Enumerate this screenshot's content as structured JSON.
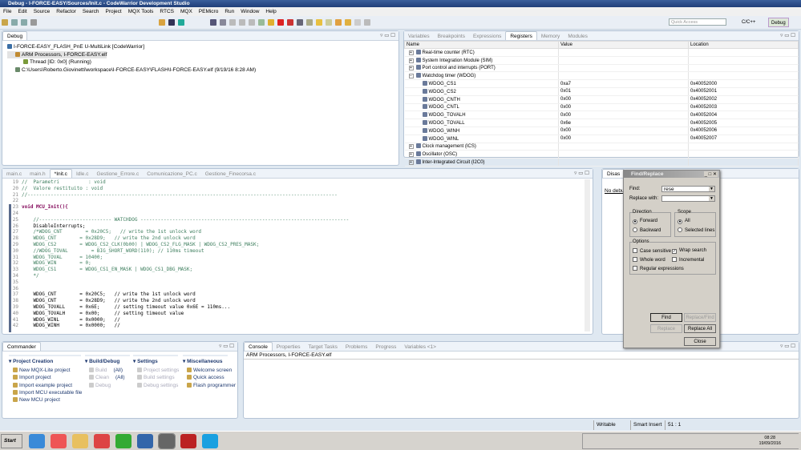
{
  "window": {
    "title": "Debug - I-FORCE-EASY/Sources/Init.c - CodeWarrior Development Studio"
  },
  "menu": [
    "File",
    "Edit",
    "Source",
    "Refactor",
    "Search",
    "Project",
    "MQX Tools",
    "RTCS",
    "MQX",
    "PEMicro",
    "Run",
    "Window",
    "Help"
  ],
  "toolbar": {
    "quick_access_placeholder": "Quick Access",
    "perspectives": [
      "C/C++",
      "Debug"
    ]
  },
  "debug_view": {
    "tab": "Debug",
    "tree": [
      {
        "label": "I-FORCE-EASY_FLASH_PnE U-MultiLink [CodeWarrior]",
        "level": 0
      },
      {
        "label": "ARM Processors, I-FORCE-EASY.elf",
        "level": 1
      },
      {
        "label": "Thread [ID: 0x0] (Running)",
        "level": 2
      },
      {
        "label": "C:\\Users\\Roberto.Giovinetti\\workspace\\I-FORCE-EASY\\FLASH\\I-FORCE-EASY.elf (9/19/16 8:28 AM)",
        "level": 1
      }
    ]
  },
  "registers_view": {
    "tabs": [
      "Variables",
      "Breakpoints",
      "Expressions",
      "Registers",
      "Memory",
      "Modules"
    ],
    "active_tab": "Registers",
    "columns": [
      "Name",
      "Value",
      "Location"
    ],
    "rows": [
      {
        "name": "Real-time counter (RTC)",
        "value": "",
        "location": "",
        "group": true
      },
      {
        "name": "System Integration Module (SIM)",
        "value": "",
        "location": "",
        "group": true
      },
      {
        "name": "Port control and interrupts (PORT)",
        "value": "",
        "location": "",
        "group": true
      },
      {
        "name": "Watchdog timer (WDOG)",
        "value": "",
        "location": "",
        "group": true,
        "expanded": true
      },
      {
        "name": "WDOG_CS1",
        "value": "0xa7",
        "location": "0x40052000"
      },
      {
        "name": "WDOG_CS2",
        "value": "0x01",
        "location": "0x40052001"
      },
      {
        "name": "WDOG_CNTH",
        "value": "0x00",
        "location": "0x40052002"
      },
      {
        "name": "WDOG_CNTL",
        "value": "0x00",
        "location": "0x40052003"
      },
      {
        "name": "WDOG_TOVALH",
        "value": "0x00",
        "location": "0x40052004"
      },
      {
        "name": "WDOG_TOVALL",
        "value": "0x6e",
        "location": "0x40052005"
      },
      {
        "name": "WDOG_WINH",
        "value": "0x00",
        "location": "0x40052006"
      },
      {
        "name": "WDOG_WINL",
        "value": "0x00",
        "location": "0x40052007"
      },
      {
        "name": "Clock management (ICS)",
        "value": "",
        "location": "",
        "group": true
      },
      {
        "name": "Oscillator (OSC)",
        "value": "",
        "location": "",
        "group": true
      },
      {
        "name": "Inter-Integrated Circuit (I2C0)",
        "value": "",
        "location": "",
        "group": true
      }
    ]
  },
  "editor": {
    "tabs": [
      "main.c",
      "main.h",
      "*Init.c",
      "Idle.c",
      "Gestione_Errore.c",
      "Comunicazione_PC.c",
      "Gestione_Finecorsa.c"
    ],
    "active_tab": "*Init.c",
    "lines": [
      {
        "n": "19",
        "text": "//  Parametri          : void"
      },
      {
        "n": "20",
        "text": "//  Valore restituito : void"
      },
      {
        "n": "21",
        "text": "//-----------------------------------------------------------------------------------------------------------"
      },
      {
        "n": "22",
        "text": ""
      },
      {
        "n": "23",
        "text": "void MCU_Init(){"
      },
      {
        "n": "24",
        "text": ""
      },
      {
        "n": "25",
        "text": "    //------------------------- WATCHDOG ------------------------------------------------------------------------"
      },
      {
        "n": "26",
        "text": "    DisableInterrupts;"
      },
      {
        "n": "27",
        "text": "    /*WDOG_CNT        = 0x20C5;   // write the 1st unlock word"
      },
      {
        "n": "28",
        "text": "    WDOG_CNT        = 0x28D9;   // write the 2nd unlock word"
      },
      {
        "n": "29",
        "text": "    WDOG_CS2        = WDOG_CS2_CLK(0b00) | WDOG_CS2_FLG_MASK | WDOG_CS2_PRES_MASK;"
      },
      {
        "n": "30",
        "text": "    //WDOG_TOVAL        = BIG_SHORT_WORD(110); // 110ms timeout"
      },
      {
        "n": "31",
        "text": "    WDOG_TOVAL      = 10400;"
      },
      {
        "n": "32",
        "text": "    WDOG_WIN        = 0;"
      },
      {
        "n": "33",
        "text": "    WDOG_CS1        = WDOG_CS1_EN_MASK | WDOG_CS1_DBG_MASK;"
      },
      {
        "n": "34",
        "text": "    */"
      },
      {
        "n": "35",
        "text": ""
      },
      {
        "n": "36",
        "text": ""
      },
      {
        "n": "37",
        "text": "    WDOG_CNT        = 0x20C5;   // write the 1st unlock word"
      },
      {
        "n": "38",
        "text": "    WDOG_CNT        = 0x28D9;   // write the 2nd unlock word"
      },
      {
        "n": "39",
        "text": "    WDOG_TOVALL     = 0x6E;     // setting timeout value 0x6E = 110ms..."
      },
      {
        "n": "40",
        "text": "    WDOG_TOVALH     = 0x00;     // setting timeout value"
      },
      {
        "n": "41",
        "text": "    WDOG_WINL       = 0x0000;   //"
      },
      {
        "n": "42",
        "text": "    WDOG_WINH       = 0x0000;   //"
      }
    ]
  },
  "disassembly": {
    "tab": "Disas",
    "message": "No debug"
  },
  "find_dialog": {
    "title": "Find/Replace",
    "find_label": "Find:",
    "find_value": "rese",
    "replace_label": "Replace with:",
    "replace_value": "",
    "direction_label": "Direction",
    "forward": "Forward",
    "backward": "Backward",
    "scope_label": "Scope",
    "all": "All",
    "selected_lines": "Selected lines",
    "options_label": "Options",
    "case_sensitive": "Case sensitive",
    "wrap_search": "Wrap search",
    "whole_word": "Whole word",
    "incremental": "Incremental",
    "regex": "Regular expressions",
    "find_btn": "Find",
    "replace_find_btn": "Replace/Find",
    "replace_btn": "Replace",
    "replace_all_btn": "Replace All",
    "close_btn": "Close",
    "direction": "Forward",
    "scope": "All",
    "wrap_checked": true
  },
  "commander": {
    "tab": "Commander",
    "columns": [
      {
        "title": "Project Creation",
        "items": [
          {
            "label": "New MQX-Lite project"
          },
          {
            "label": "Import project"
          },
          {
            "label": "Import example project"
          },
          {
            "label": "Import MCU executable file"
          },
          {
            "label": "New MCU project"
          }
        ]
      },
      {
        "title": "Build/Debug",
        "items": [
          {
            "label": "Build",
            "extra": "(All)",
            "disabled": true
          },
          {
            "label": "Clean",
            "extra": "(All)",
            "disabled": true
          },
          {
            "label": "Debug",
            "disabled": true
          }
        ]
      },
      {
        "title": "Settings",
        "items": [
          {
            "label": "Project settings",
            "disabled": true
          },
          {
            "label": "Build settings",
            "disabled": true
          },
          {
            "label": "Debug settings",
            "disabled": true
          }
        ]
      },
      {
        "title": "Miscellaneous",
        "items": [
          {
            "label": "Welcome screen"
          },
          {
            "label": "Quick access"
          },
          {
            "label": "Flash programmer"
          }
        ]
      }
    ]
  },
  "console": {
    "tabs": [
      "Console",
      "Properties",
      "Target Tasks",
      "Problems",
      "Progress",
      "Variables <1>"
    ],
    "active_tab": "Console",
    "header": "ARM Processors, I-FORCE-EASY.elf"
  },
  "status": {
    "writable": "Writable",
    "insert_mode": "Smart Insert",
    "position": "51 : 1"
  },
  "taskbar": {
    "start": "Start",
    "time": "08:28",
    "date": "19/09/2016"
  }
}
